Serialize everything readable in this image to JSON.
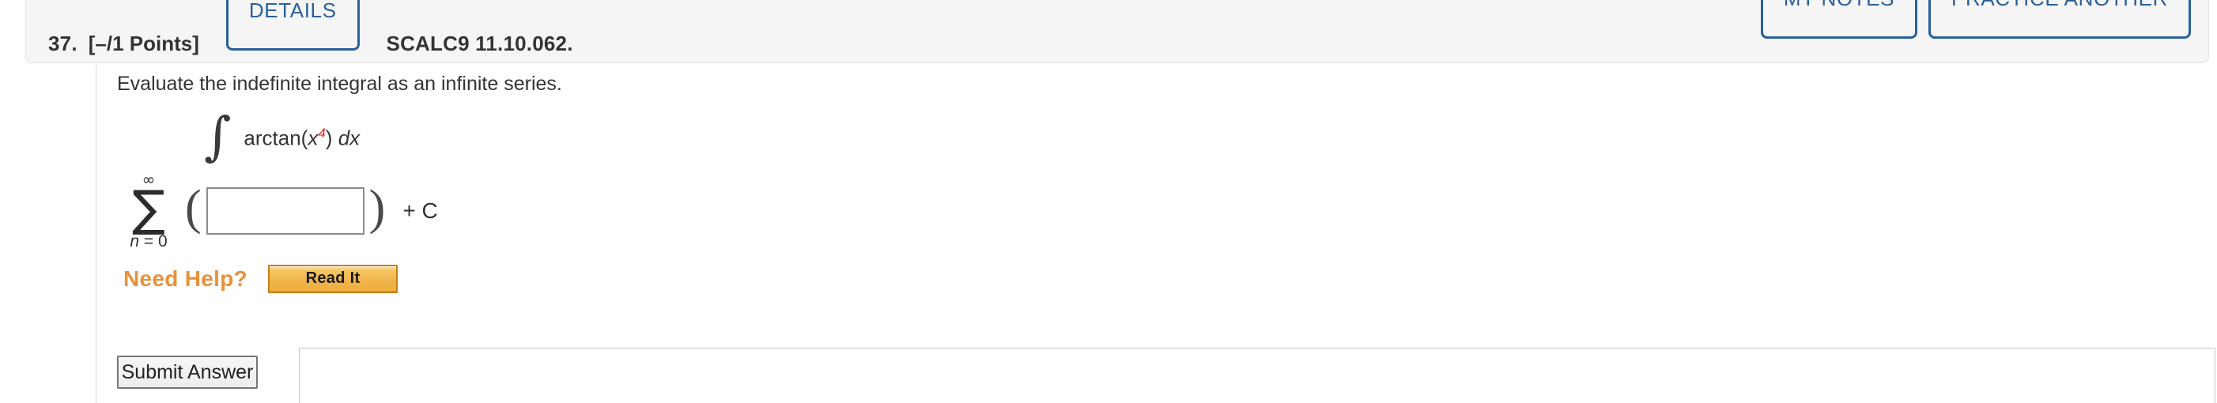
{
  "header": {
    "question_number": "37.",
    "points": "[–/1 Points]",
    "details_label": "DETAILS",
    "reference": "SCALC9 11.10.062.",
    "my_notes_label": "MY NOTES",
    "practice_another_label": "PRACTICE ANOTHER",
    "accent_blue": "#2a6099",
    "panel_background": "#f5f5f5"
  },
  "question": {
    "prompt": "Evaluate the indefinite integral as an infinite series.",
    "integral": {
      "integral_sign": "∫",
      "function_prefix": "arctan(",
      "variable": "x",
      "exponent": "4",
      "exponent_color": "#d6291e",
      "function_suffix": ")",
      "differential": "dx"
    },
    "answer_expression": {
      "sigma_glyph": "∑",
      "upper_limit": "∞",
      "lower_limit_var": "n",
      "lower_limit_eq": " = ",
      "lower_limit_value": "0",
      "open_paren": "(",
      "close_paren": ")",
      "trailing": "+ C",
      "input_value": "",
      "input_placeholder": ""
    }
  },
  "help": {
    "label": "Need Help?",
    "read_it_label": "Read It",
    "accent_orange": "#e8913a"
  },
  "actions": {
    "submit_label": "Submit Answer"
  }
}
